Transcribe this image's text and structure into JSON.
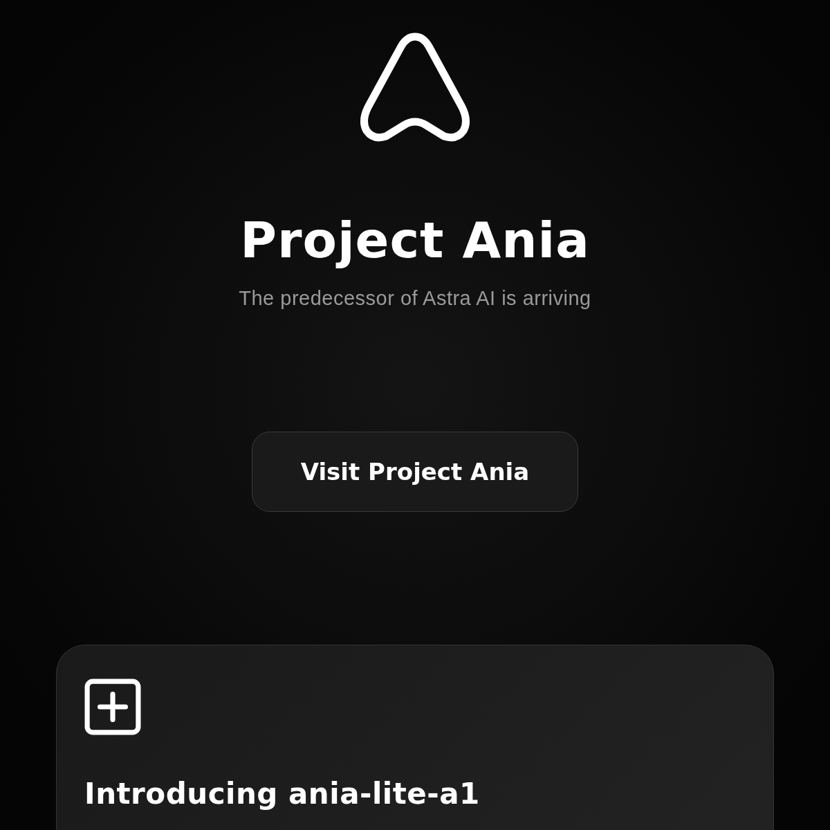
{
  "hero": {
    "title": "Project Ania",
    "subtitle": "The predecessor of Astra AI is arriving"
  },
  "button": {
    "label": "Visit Project Ania"
  },
  "card": {
    "heading": "Introducing ania-lite-a1"
  }
}
